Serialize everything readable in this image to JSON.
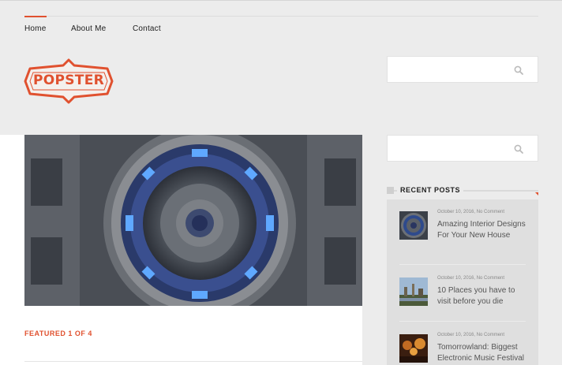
{
  "nav": {
    "items": [
      {
        "label": "Home"
      },
      {
        "label": "About Me"
      },
      {
        "label": "Contact"
      }
    ]
  },
  "logo": {
    "text": "POPSTER"
  },
  "search": {
    "placeholder": ""
  },
  "featured": {
    "label": "FEATURED 1 OF 4"
  },
  "recent_posts": {
    "title": "RECENT POSTS",
    "posts": [
      {
        "date": "October 10, 2016",
        "comments": "No Comment",
        "title": "Amazing Interior Designs For Your New House"
      },
      {
        "date": "October 10, 2016",
        "comments": "No Comment",
        "title": "10 Places you have to visit before you die"
      },
      {
        "date": "October 10, 2016",
        "comments": "No Comment",
        "title": "Tomorrowland: Biggest Electronic Music Festival"
      }
    ]
  },
  "colors": {
    "accent": "#e0512f",
    "background": "#ececec",
    "sidebar_panel": "#dfdfdf"
  },
  "icons": {
    "search": "magnifier-icon"
  }
}
